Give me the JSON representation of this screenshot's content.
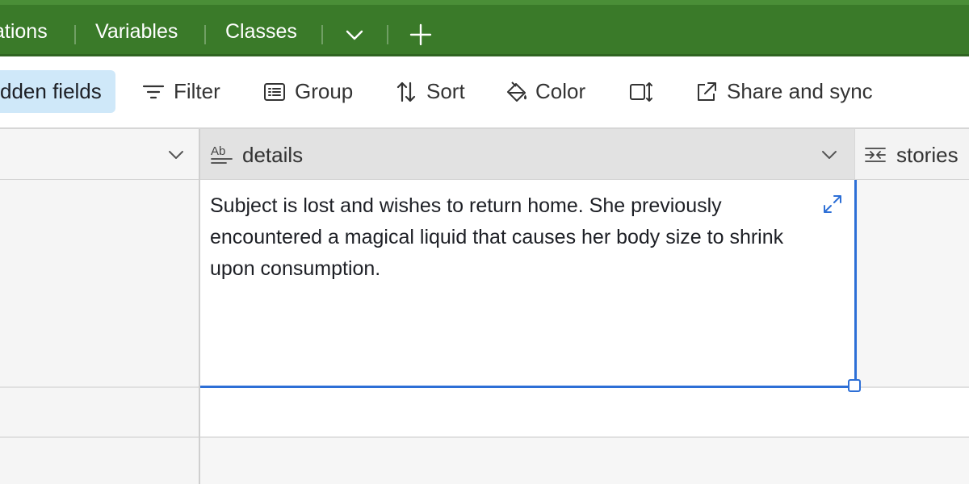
{
  "tabs": [
    {
      "label": "ations"
    },
    {
      "label": "Variables"
    },
    {
      "label": "Classes"
    }
  ],
  "tab_icons": {
    "more": "chevron-down-icon",
    "add": "plus-icon"
  },
  "toolbar": {
    "hidden_fields_label": "dden fields",
    "filter_label": "Filter",
    "group_label": "Group",
    "sort_label": "Sort",
    "color_label": "Color",
    "row_height_icon": "row-height-icon",
    "share_label": "Share and sync"
  },
  "columns": {
    "details": {
      "label": "details",
      "icon": "long-text-icon"
    },
    "stories": {
      "label": "stories",
      "icon": "link-record-icon"
    }
  },
  "active_cell": {
    "text": "Subject is lost and wishes to return home. She previously encountered a magical liquid that causes her body size to shrink upon consumption."
  },
  "colors": {
    "tabbar_green": "#3a7a29",
    "selection_blue": "#2d6fd6",
    "hidden_fields_bg": "#cfe8f9"
  }
}
